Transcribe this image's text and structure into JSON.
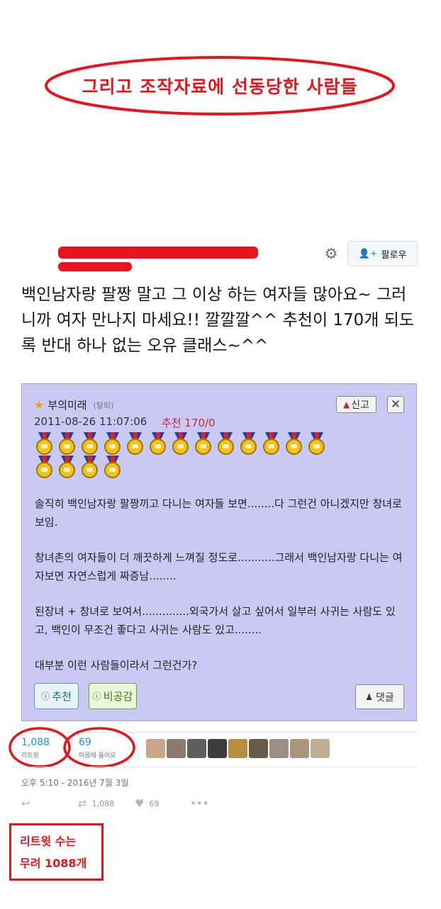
{
  "headline": "그리고 조작자료에 선동당한 사람들",
  "header": {
    "follow_label": "팔로우",
    "follow_icon": "add-user-icon",
    "settings_icon": "gear-icon"
  },
  "tweet": {
    "text": "백인남자랑 팔짱 말고 그 이상 하는 여자들 많아요~ 그러니까 여자 만나지 마세요!!  깔깔깔^^ 추천이 170개 되도록 반대 하나 없는 오유 클래스~^^"
  },
  "card": {
    "author": "부의미래",
    "author_status": "(탈퇴)",
    "report_label": "신고",
    "close_label": "✕",
    "datetime": "2011-08-26 11:07:06",
    "recommend": "추천 170/0",
    "medals": 17,
    "paragraphs": [
      "솔직히 백인남자랑 팔짱끼고 다니는 여자들 보면........다 그런건 아니겠지만 창녀로 보임.",
      "창녀촌의 여자들이 더 깨끗하게 느껴질 정도로...........그래서 백인남자랑 다니는 여자보면 자연스럽게 짜증남........",
      "된장녀 + 창녀로 보여서..............외국가서 살고 싶어서 일부러 사귀는 사람도 있고, 백인이 무조건 좋다고 사귀는 사람도 있고........",
      "대부분 이런 사람들이라서 그런건가?"
    ],
    "recommend_btn": "추천",
    "not_agree_btn": "비공감",
    "reply_btn": "댓글"
  },
  "stats": {
    "retweets": "1,088",
    "retweets_label": "리트윗",
    "likes": "69",
    "likes_label": "마음에 들어요"
  },
  "timestamp": "오후 5:10 - 2016년 7월 3일",
  "actions": {
    "retweet_count": "1,088",
    "like_count": "69"
  },
  "note": {
    "line1": "리트윗 수는",
    "line2": "무려 1088개"
  },
  "colors": {
    "accent_red": "#e8141b",
    "twitter_blue": "#1b95e0",
    "card_bg": "#c9c9f4"
  }
}
